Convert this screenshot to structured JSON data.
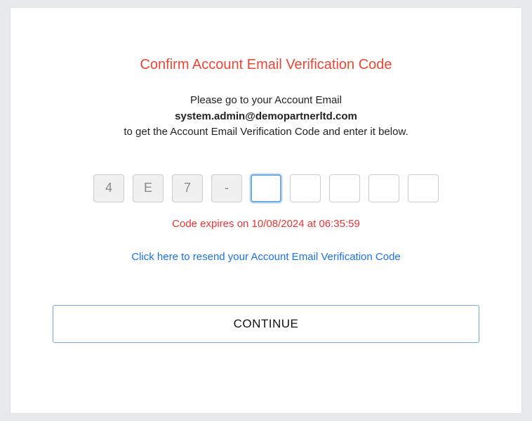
{
  "title": "Confirm Account Email Verification Code",
  "instruction": {
    "line1": "Please go to your Account Email",
    "email": "system.admin@demopartnerltd.com",
    "line2": "to get the Account Email Verification Code and enter it below."
  },
  "code": {
    "boxes": [
      {
        "value": "4",
        "filled": true,
        "focused": false
      },
      {
        "value": "E",
        "filled": true,
        "focused": false
      },
      {
        "value": "7",
        "filled": true,
        "focused": false
      },
      {
        "value": "-",
        "filled": true,
        "focused": false
      },
      {
        "value": "",
        "filled": false,
        "focused": true
      },
      {
        "value": "",
        "filled": false,
        "focused": false
      },
      {
        "value": "",
        "filled": false,
        "focused": false
      },
      {
        "value": "",
        "filled": false,
        "focused": false
      },
      {
        "value": "",
        "filled": false,
        "focused": false
      }
    ]
  },
  "expiry": "Code expires on 10/08/2024 at 06:35:59",
  "resend": "Click here to resend your Account Email Verification Code",
  "continue_label": "CONTINUE"
}
